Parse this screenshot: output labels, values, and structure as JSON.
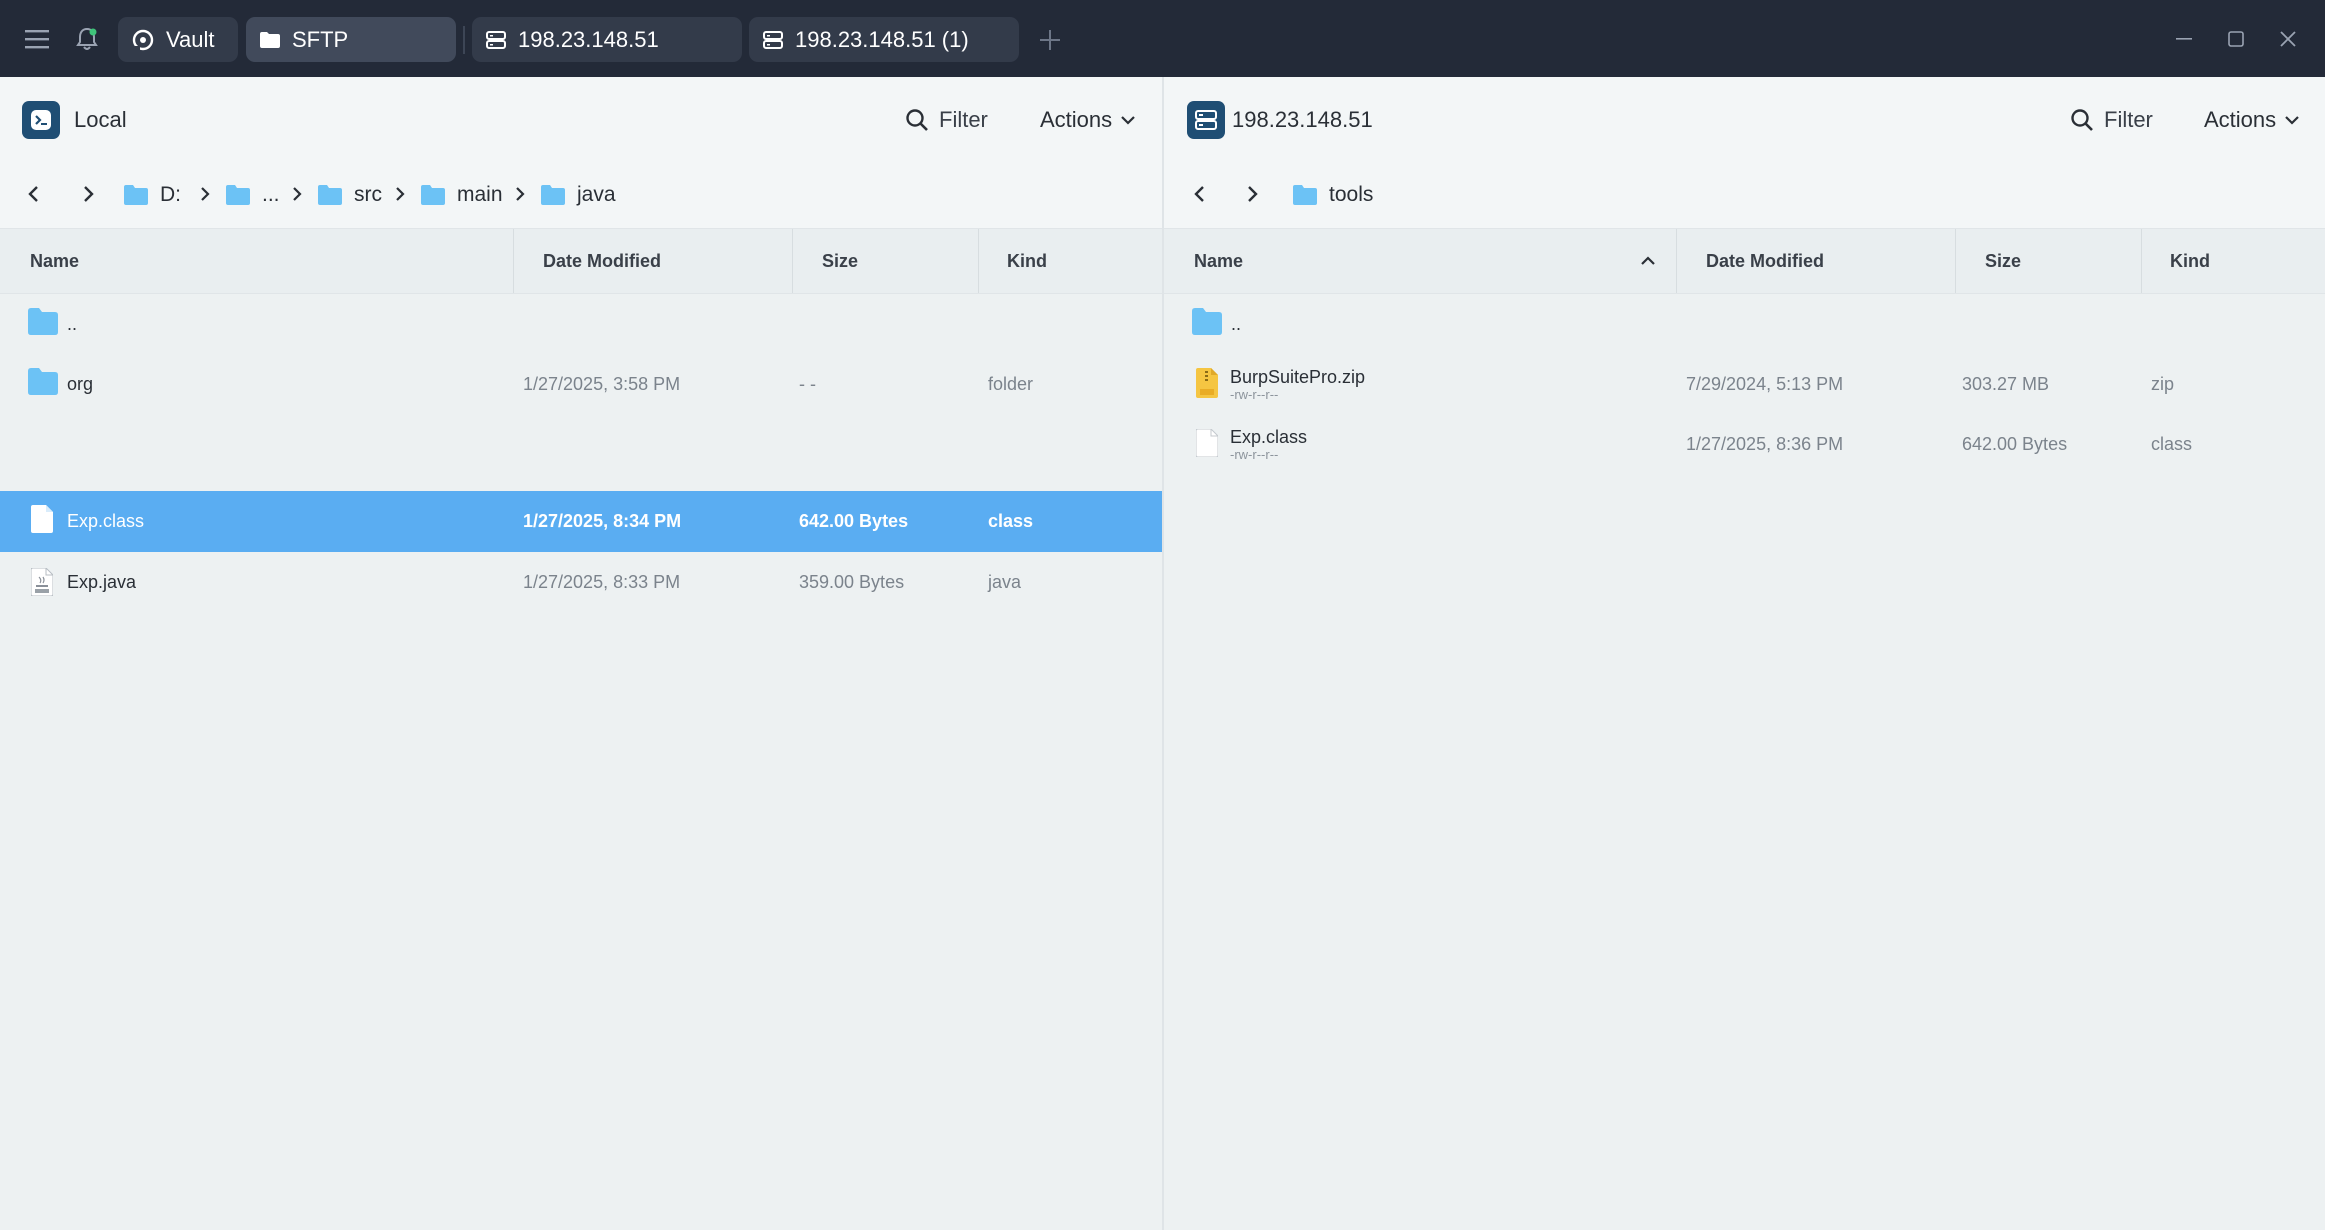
{
  "titlebar": {
    "tabs": [
      {
        "label": "Vault",
        "icon": "vault-icon"
      },
      {
        "label": "SFTP",
        "icon": "folder-icon"
      },
      {
        "label": "198.23.148.51",
        "icon": "server-icon"
      },
      {
        "label": "198.23.148.51 (1)",
        "icon": "server-icon"
      }
    ],
    "active_tab": "SFTP"
  },
  "local": {
    "title": "Local",
    "filter_label": "Filter",
    "actions_label": "Actions",
    "breadcrumb": [
      "D:",
      "...",
      "src",
      "main",
      "java"
    ],
    "columns": [
      "Name",
      "Date Modified",
      "Size",
      "Kind"
    ],
    "rows": [
      {
        "name": "..",
        "date": "",
        "size": "",
        "kind": "",
        "icon": "folder-icon"
      },
      {
        "name": "org",
        "date": "1/27/2025, 3:58 PM",
        "size": "- -",
        "kind": "folder",
        "icon": "folder-icon"
      },
      {
        "name": "Exp.class",
        "date": "1/27/2025, 8:34 PM",
        "size": "642.00 Bytes",
        "kind": "class",
        "icon": "file-icon",
        "selected": true
      },
      {
        "name": "Exp.java",
        "date": "1/27/2025, 8:33 PM",
        "size": "359.00 Bytes",
        "kind": "java",
        "icon": "java-file-icon"
      }
    ]
  },
  "remote": {
    "title": "198.23.148.51",
    "filter_label": "Filter",
    "actions_label": "Actions",
    "breadcrumb": [
      "tools"
    ],
    "columns": [
      "Name",
      "Date Modified",
      "Size",
      "Kind"
    ],
    "sort": {
      "column": "Name",
      "direction": "ascending"
    },
    "rows": [
      {
        "name": "..",
        "permissions": "",
        "date": "",
        "size": "",
        "kind": "",
        "icon": "folder-icon"
      },
      {
        "name": "BurpSuitePro.zip",
        "permissions": "-rw-r--r--",
        "date": "7/29/2024, 5:13 PM",
        "size": "303.27 MB",
        "kind": "zip",
        "icon": "zip-file-icon"
      },
      {
        "name": "Exp.class",
        "permissions": "-rw-r--r--",
        "date": "1/27/2025, 8:36 PM",
        "size": "642.00 Bytes",
        "kind": "class",
        "icon": "file-icon"
      }
    ]
  },
  "colors": {
    "titlebar_bg": "#232a38",
    "selection": "#5aadf2",
    "folder": "#6cc2f5",
    "pane_icon_bg": "#1f4e74"
  }
}
